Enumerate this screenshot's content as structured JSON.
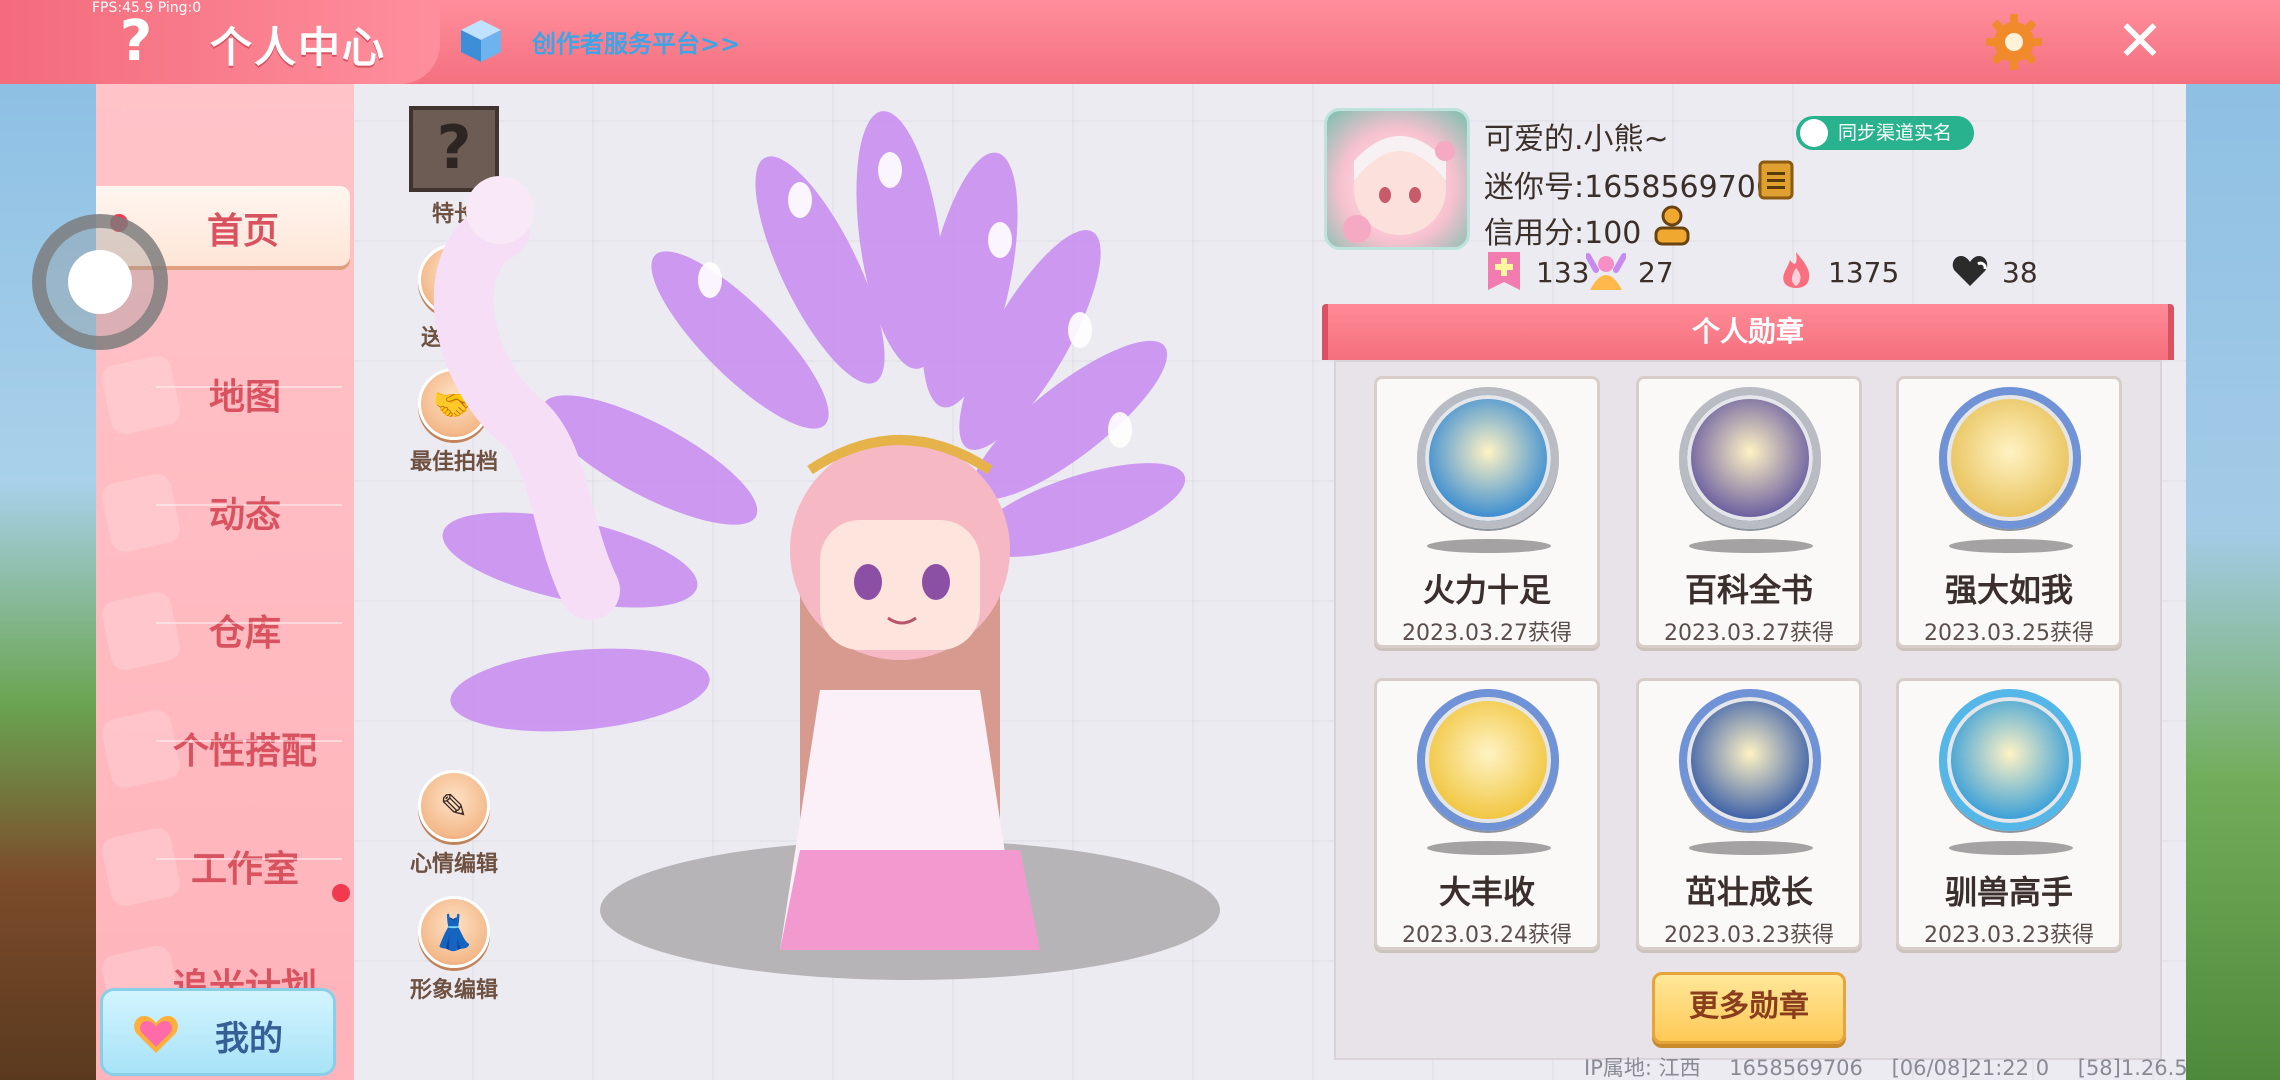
{
  "debug": {
    "fps_text": "FPS:45.9  Ping:0"
  },
  "header": {
    "title": "个人中心",
    "creator_link": "创作者服务平台>>",
    "help_glyph": "?",
    "close_glyph": "✕"
  },
  "sidebar": {
    "items": [
      {
        "label": "首页",
        "active": true
      },
      {
        "label": "地图"
      },
      {
        "label": "动态"
      },
      {
        "label": "仓库"
      },
      {
        "label": "个性搭配"
      },
      {
        "label": "工作室"
      },
      {
        "label": "追光计划"
      }
    ],
    "mine_label": "我的"
  },
  "actions": {
    "specialty": {
      "label": "特长",
      "glyph": "?"
    },
    "gift": {
      "label": "送礼物"
    },
    "best_partner": {
      "label": "最佳拍档"
    },
    "mood_edit": {
      "label": "心情编辑"
    },
    "look_edit": {
      "label": "形象编辑"
    }
  },
  "profile": {
    "nickname": "可爱的.小熊~",
    "sync_label": "同步渠道实名",
    "mini_id": "迷你号:1658569706",
    "credit": "信用分:100",
    "stats": {
      "stat1": "133",
      "stat2": "27",
      "hot": "1375",
      "likes": "38"
    }
  },
  "medals": {
    "title": "个人勋章",
    "items": [
      {
        "name": "火力十足",
        "date": "2023.03.27获得",
        "ring": "#b9bcc2",
        "fill": "#3d8ed1"
      },
      {
        "name": "百科全书",
        "date": "2023.03.27获得",
        "ring": "#b9bcc2",
        "fill": "#6b5fa0"
      },
      {
        "name": "强大如我",
        "date": "2023.03.25获得",
        "ring": "#6f93d6",
        "fill": "#e9c35d"
      },
      {
        "name": "大丰收",
        "date": "2023.03.24获得",
        "ring": "#6f93d6",
        "fill": "#f1c640"
      },
      {
        "name": "茁壮成长",
        "date": "2023.03.23获得",
        "ring": "#6f93d6",
        "fill": "#3f62a8"
      },
      {
        "name": "驯兽高手",
        "date": "2023.03.23获得",
        "ring": "#55b7e8",
        "fill": "#3ba0d8"
      }
    ],
    "more_label": "更多勋章"
  },
  "footer": {
    "ip": "IP属地: 江西",
    "uid": "1658569706",
    "time": "[06/08]21:22 0",
    "version": "[58]1.26.5"
  },
  "colors": {
    "accent": "#f4707f",
    "sidebar": "#ffb3ba",
    "nav_text": "#d8525f"
  }
}
